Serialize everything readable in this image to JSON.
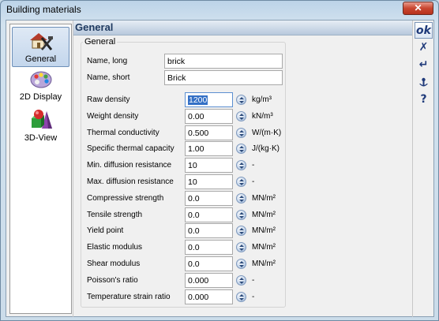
{
  "window": {
    "title": "Building materials",
    "close_glyph": "✕"
  },
  "nav": {
    "items": [
      {
        "label": "General",
        "icon": "house-tools-icon",
        "selected": true
      },
      {
        "label": "2D Display",
        "icon": "palette-icon",
        "selected": false
      },
      {
        "label": "3D-View",
        "icon": "3d-shapes-icon",
        "selected": false
      }
    ]
  },
  "header": {
    "title": "General"
  },
  "group": {
    "legend": "General",
    "name_long_label": "Name, long",
    "name_long_value": "brick",
    "name_short_label": "Name, short",
    "name_short_value": "Brick",
    "properties": [
      {
        "label": "Raw density",
        "value": "1200",
        "unit": "kg/m³"
      },
      {
        "label": "Weight density",
        "value": "0.00",
        "unit": "kN/m³"
      },
      {
        "label": "Thermal conductivity",
        "value": "0.500",
        "unit": "W/(m·K)"
      },
      {
        "label": "Specific thermal capacity",
        "value": "1.00",
        "unit": "J/(kg·K)"
      },
      {
        "label": "Min. diffusion resistance",
        "value": "10",
        "unit": "-"
      },
      {
        "label": "Max. diffusion resistance",
        "value": "10",
        "unit": "-"
      },
      {
        "label": "Compressive strength",
        "value": "0.0",
        "unit": "MN/m²"
      },
      {
        "label": "Tensile strength",
        "value": "0.0",
        "unit": "MN/m²"
      },
      {
        "label": "Yield point",
        "value": "0.0",
        "unit": "MN/m²"
      },
      {
        "label": "Elastic modulus",
        "value": "0.0",
        "unit": "MN/m²"
      },
      {
        "label": "Shear modulus",
        "value": "0.0",
        "unit": "MN/m²"
      },
      {
        "label": "Poisson's ratio",
        "value": "0.000",
        "unit": "-"
      },
      {
        "label": "Temperature strain ratio",
        "value": "0.000",
        "unit": "-"
      }
    ]
  },
  "toolbar": {
    "ok_label": "ok",
    "cancel_glyph": "✗",
    "enter_glyph": "↵",
    "help_glyph": "?"
  }
}
